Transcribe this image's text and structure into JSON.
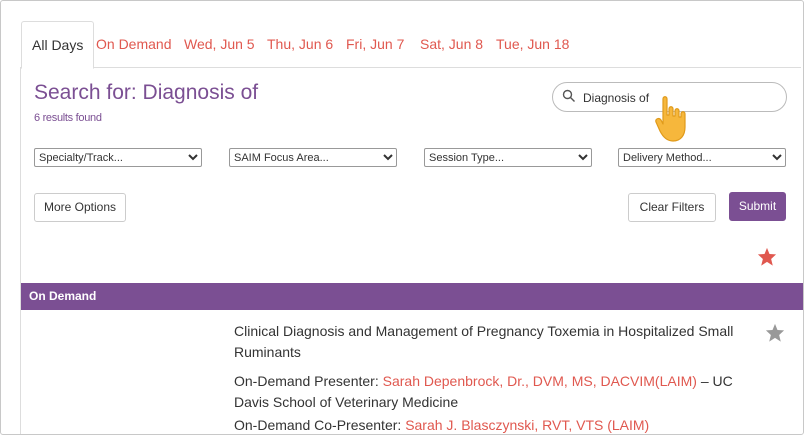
{
  "tabs": [
    "All Days",
    "On Demand",
    "Wed, Jun 5",
    "Thu, Jun 6",
    "Fri, Jun 7",
    "Sat, Jun 8",
    "Tue, Jun 18"
  ],
  "search": {
    "title": "Search for: Diagnosis of",
    "results_count": "6 results found",
    "query": "Diagnosis of"
  },
  "filters": {
    "specialty": "Specialty/Track...",
    "focus": "SAIM Focus Area...",
    "session_type": "Session Type...",
    "delivery": "Delivery Method..."
  },
  "buttons": {
    "more_options": "More Options",
    "clear_filters": "Clear Filters",
    "submit": "Submit"
  },
  "section": {
    "title": "On Demand"
  },
  "session": {
    "title": "Clinical Diagnosis and Management of Pregnancy Toxemia in Hospitalized Small Ruminants",
    "presenter_label": "On-Demand Presenter: ",
    "presenter_name": "Sarah Depenbrock, Dr., DVM, MS, DACVIM(LAIM)",
    "presenter_affil": " – UC Davis School of Veterinary Medicine",
    "copresenter_label": "On-Demand Co-Presenter: ",
    "copresenter_name": "Sarah J. Blasczynski, RVT, VTS (LAIM)"
  },
  "colors": {
    "accent": "#7b4f93",
    "link": "#e0584f",
    "star_active": "#e0584f",
    "star_inactive": "#999999"
  }
}
